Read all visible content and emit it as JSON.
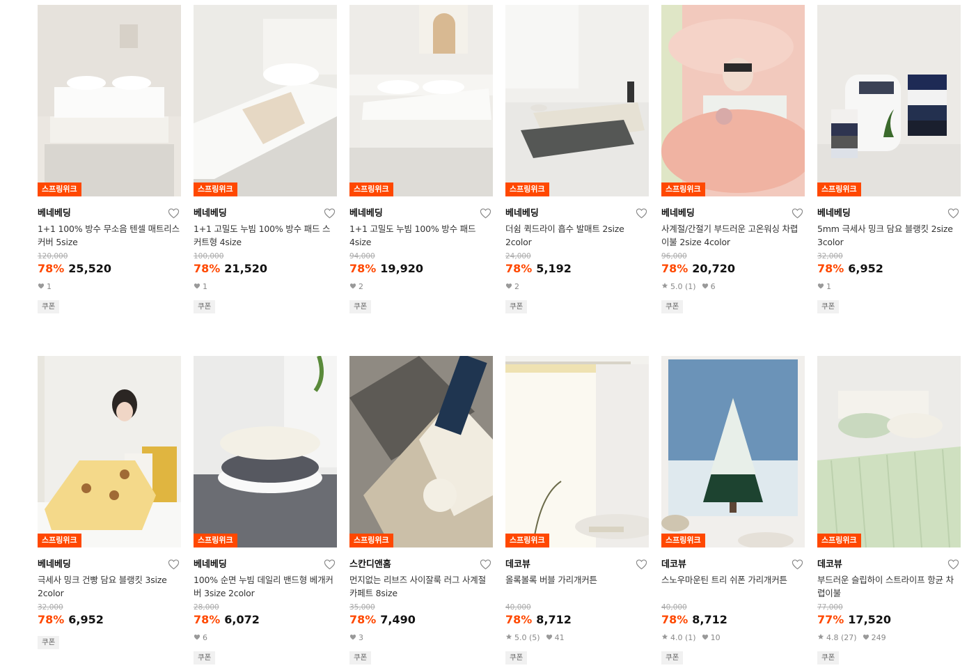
{
  "products": [
    {
      "badge": "스프링위크",
      "brand": "베네베딩",
      "name": "1+1 100% 방수 무소음 텐셀 매트리스 커버 5size",
      "orig": "120,000",
      "pct": "78%",
      "price": "25,520",
      "rating": "",
      "likes": "1",
      "coupon": "쿠폰",
      "img": "bed-white"
    },
    {
      "badge": "스프링위크",
      "brand": "베네베딩",
      "name": "1+1 고밀도 누빔 100% 방수 패드 스커트형 4size",
      "orig": "100,000",
      "pct": "78%",
      "price": "21,520",
      "rating": "",
      "likes": "1",
      "coupon": "쿠폰",
      "img": "bed-pad"
    },
    {
      "badge": "스프링위크",
      "brand": "베네베딩",
      "name": "1+1 고밀도 누빔 100% 방수 패드 4size",
      "orig": "94,000",
      "pct": "78%",
      "price": "19,920",
      "rating": "",
      "likes": "2",
      "coupon": "쿠폰",
      "img": "bed-arch"
    },
    {
      "badge": "스프링위크",
      "brand": "베네베딩",
      "name": "더쉼 퀵드라이 흡수 발매트 2size 2color",
      "orig": "24,000",
      "pct": "78%",
      "price": "5,192",
      "rating": "",
      "likes": "2",
      "coupon": "쿠폰",
      "img": "bathmat"
    },
    {
      "badge": "스프링위크",
      "brand": "베네베딩",
      "name": "사계절/간절기 부드러운 고온워싱 차렵이불 2size 4color",
      "orig": "96,000",
      "pct": "78%",
      "price": "20,720",
      "rating": "5.0 (1)",
      "likes": "6",
      "coupon": "쿠폰",
      "img": "pink-bed"
    },
    {
      "badge": "스프링위크",
      "brand": "베네베딩",
      "name": "5mm 극세사 밍크 담요 블랭킷 2size 3color",
      "orig": "32,000",
      "pct": "78%",
      "price": "6,952",
      "rating": "",
      "likes": "1",
      "coupon": "쿠폰",
      "img": "blankets"
    },
    {
      "badge": "스프링위크",
      "brand": "베네베딩",
      "name": "극세사 밍크 건빵 담요 블랭킷 3size 2color",
      "orig": "32,000",
      "pct": "78%",
      "price": "6,952",
      "rating": "",
      "likes": "",
      "coupon": "쿠폰",
      "img": "yellow-blanket"
    },
    {
      "badge": "스프링위크",
      "brand": "베네베딩",
      "name": "100% 순면 누빔 데일리 밴드형 베개커버 3size 2color",
      "orig": "28,000",
      "pct": "78%",
      "price": "6,072",
      "rating": "",
      "likes": "6",
      "coupon": "쿠폰",
      "img": "pillows"
    },
    {
      "badge": "스프링위크",
      "brand": "스칸디앤홈",
      "name": "먼지없는 리브즈 사이잘룩 러그 사계절 카페트 8size",
      "orig": "35,000",
      "pct": "78%",
      "price": "7,490",
      "rating": "",
      "likes": "3",
      "coupon": "쿠폰",
      "img": "rugs"
    },
    {
      "badge": "스프링위크",
      "brand": "데코뷰",
      "name": "올록볼록 버블 가리개커튼",
      "orig": "40,000",
      "pct": "78%",
      "price": "8,712",
      "rating": "5.0 (5)",
      "likes": "41",
      "coupon": "쿠폰",
      "img": "curtain"
    },
    {
      "badge": "스프링위크",
      "brand": "데코뷰",
      "name": "스노우마운틴 트리 쉬폰 가리개커튼",
      "orig": "40,000",
      "pct": "78%",
      "price": "8,712",
      "rating": "4.0 (1)",
      "likes": "10",
      "coupon": "쿠폰",
      "img": "tree"
    },
    {
      "badge": "스프링위크",
      "brand": "데코뷰",
      "name": "부드러운 슬립하이 스트라이프 항균 차렵이불",
      "orig": "77,000",
      "pct": "77%",
      "price": "17,520",
      "rating": "4.8 (27)",
      "likes": "249",
      "coupon": "쿠폰",
      "img": "green-bed"
    }
  ]
}
